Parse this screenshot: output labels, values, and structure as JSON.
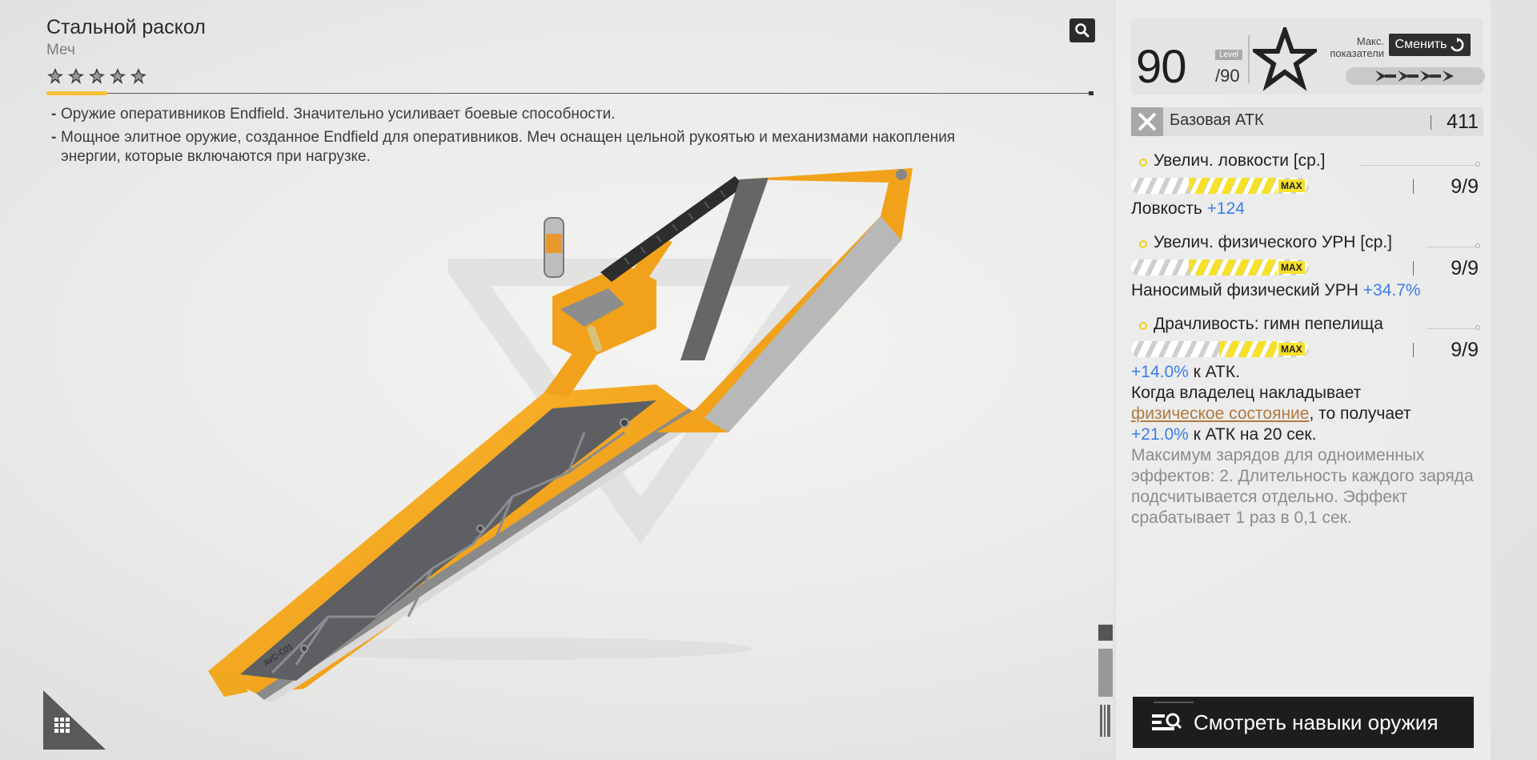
{
  "weapon": {
    "name": "Стальной раскол",
    "type": "Меч",
    "rarity": 5,
    "description": [
      "Оружие оперативников Endfield. Значительно усиливает боевые способности.",
      "Мощное элитное оружие, созданное Endfield для оперативников. Меч оснащен цельной рукоятью и механизмами накопления энергии, которые включаются при нагрузке."
    ],
    "blade_print": "AVC-C01"
  },
  "level": {
    "current": "90",
    "max": "/90",
    "tag": "Level",
    "max_stats_label_1": "Макс.",
    "max_stats_label_2": "показатели",
    "swap_label": "Сменить"
  },
  "base_atk": {
    "label": "Базовая АТК",
    "value": "411"
  },
  "stats": [
    {
      "name": "Увелич. ловкости [ср.]",
      "progress": 1.0,
      "max_badge": "MAX",
      "rank": "9/9",
      "effect_label": "Ловкость",
      "effect_value": "+124"
    },
    {
      "name": "Увелич. физического УРН [ср.]",
      "progress": 1.0,
      "max_badge": "MAX",
      "rank": "9/9",
      "effect_label": "Наносимый физический УРН",
      "effect_value": "+34.7%"
    },
    {
      "name": "Драчливость: гимн пепелища",
      "progress": 1.0,
      "max_badge": "MAX",
      "rank": "9/9",
      "line1_value": "+14.0%",
      "line1_text": " к АТК.",
      "line2": "Когда владелец накладывает",
      "line3_link": "физическое состояние",
      "line3_rest": ", то получает",
      "line4_value": "+21.0%",
      "line4_text": " к АТК на 20 сек.",
      "note": "Максимум зарядов для одноименных эффектов: 2. Длительность каждого заряда подсчитывается отдельно. Эффект срабатывает 1 раз в 0,1 сек."
    }
  ],
  "skills_button_label": "Смотреть навыки оружия",
  "icons": [
    "search-icon",
    "rarity-star-icon",
    "rank-star-icon",
    "swap-icon",
    "sword-icon",
    "skills-icon",
    "grid-menu-icon"
  ],
  "colors": {
    "accent_yellow": "#f6e12a",
    "weapon_orange": "#f4a20e",
    "blue_value": "#3b7ee8",
    "link_orange": "#b17a3e"
  }
}
